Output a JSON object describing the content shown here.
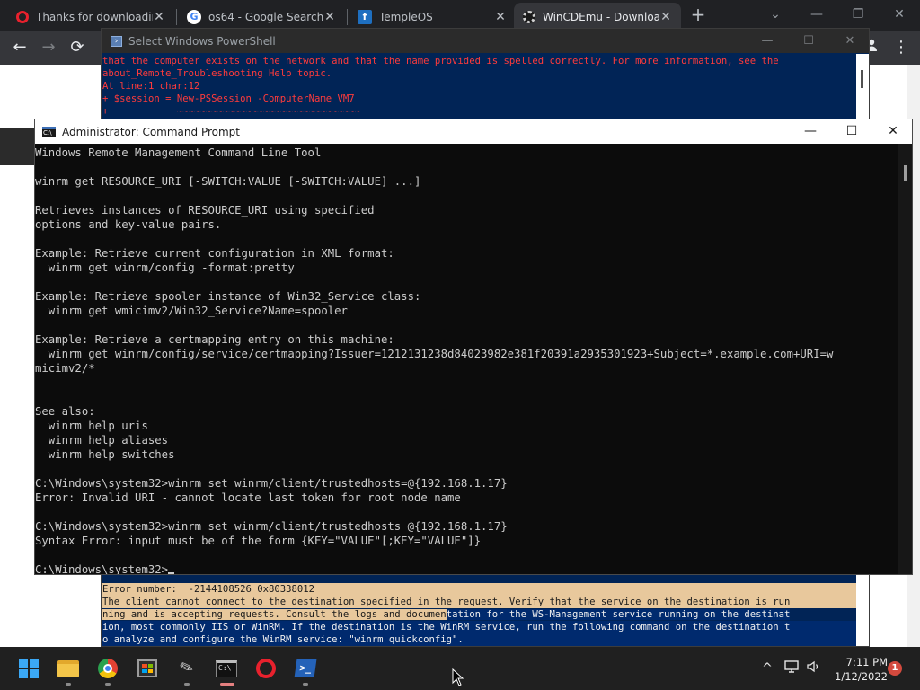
{
  "browser": {
    "tabs": [
      {
        "title": "Thanks for downloadin",
        "favicon": "opera-icon",
        "active": false
      },
      {
        "title": "os64 - Google Search",
        "favicon": "google-icon",
        "active": false
      },
      {
        "title": "TempleOS",
        "favicon": "templeos-icon",
        "active": false
      },
      {
        "title": "WinCDEmu - Downloa",
        "favicon": "gear-icon",
        "active": true
      }
    ],
    "close_glyph": "✕",
    "new_tab_glyph": "+",
    "controls": {
      "dropdown": "⌄",
      "minimize": "—",
      "restore": "❐",
      "close": "✕"
    },
    "nav": {
      "back": "←",
      "forward": "→",
      "reload": "⟳",
      "menu": "⋮"
    }
  },
  "powershell": {
    "title": "Select Windows PowerShell",
    "controls": {
      "minimize": "—",
      "maximize": "☐",
      "close": "✕"
    },
    "top_error_lines": [
      "that the computer exists on the network and that the name provided is spelled correctly. For more information, see the",
      "about_Remote_Troubleshooting Help topic.",
      "At line:1 char:12",
      "+ $session = New-PSSession -ComputerName VM7",
      "+            ~~~~~~~~~~~~~~~~~~~~~~~~~~~~~~~~"
    ],
    "bottom_error": {
      "line1": "Error number:  -2144108526 0x80338012",
      "line2": "The client cannot connect to the destination specified in the request. Verify that the service on the destination is run",
      "line3_hl": "ning and is accepting requests. Consult the logs and documen",
      "line3_rest": "tation for the WS-Management service running on the destinat",
      "line4": "ion, most commonly IIS or WinRM. If the destination is the WinRM service, run the following command on the destination t",
      "line5": "o analyze and configure the WinRM service: \"winrm quickconfig\"."
    }
  },
  "cmd": {
    "title": "Administrator: Command Prompt",
    "controls": {
      "minimize": "—",
      "maximize": "☐",
      "close": "✕"
    },
    "lines": [
      "Windows Remote Management Command Line Tool",
      "",
      "winrm get RESOURCE_URI [-SWITCH:VALUE [-SWITCH:VALUE] ...]",
      "",
      "Retrieves instances of RESOURCE_URI using specified",
      "options and key-value pairs.",
      "",
      "Example: Retrieve current configuration in XML format:",
      "  winrm get winrm/config -format:pretty",
      "",
      "Example: Retrieve spooler instance of Win32_Service class:",
      "  winrm get wmicimv2/Win32_Service?Name=spooler",
      "",
      "Example: Retrieve a certmapping entry on this machine:",
      "  winrm get winrm/config/service/certmapping?Issuer=1212131238d84023982e381f20391a2935301923+Subject=*.example.com+URI=w",
      "micimv2/*",
      "",
      "",
      "See also:",
      "  winrm help uris",
      "  winrm help aliases",
      "  winrm help switches",
      "",
      "C:\\Windows\\system32>winrm set winrm/client/trustedhosts=@{192.168.1.17}",
      "Error: Invalid URI - cannot locate last token for root node name",
      "",
      "C:\\Windows\\system32>winrm set winrm/client/trustedhosts @{192.168.1.17}",
      "Syntax Error: input must be of the form {KEY=\"VALUE\"[;KEY=\"VALUE\"]}",
      ""
    ],
    "prompt": "C:\\Windows\\system32>"
  },
  "taskbar": {
    "apps": [
      {
        "name": "start-button-icon"
      },
      {
        "name": "file-explorer-icon"
      },
      {
        "name": "chrome-icon"
      },
      {
        "name": "microsoft-store-icon"
      },
      {
        "name": "snipping-tool-icon"
      },
      {
        "name": "command-prompt-icon"
      },
      {
        "name": "opera-icon"
      },
      {
        "name": "powershell-icon"
      }
    ],
    "tray": {
      "chevron": "^",
      "network": "🖵",
      "volume": "🔈"
    },
    "time": "7:11 PM",
    "date": "1/12/2022",
    "notification_count": "1"
  },
  "colors": {
    "ps_background": "#012456",
    "ps_error": "#ff3b3b",
    "cmd_background": "#0c0c0c",
    "cmd_text": "#cccccc",
    "taskbar": "#202020"
  }
}
